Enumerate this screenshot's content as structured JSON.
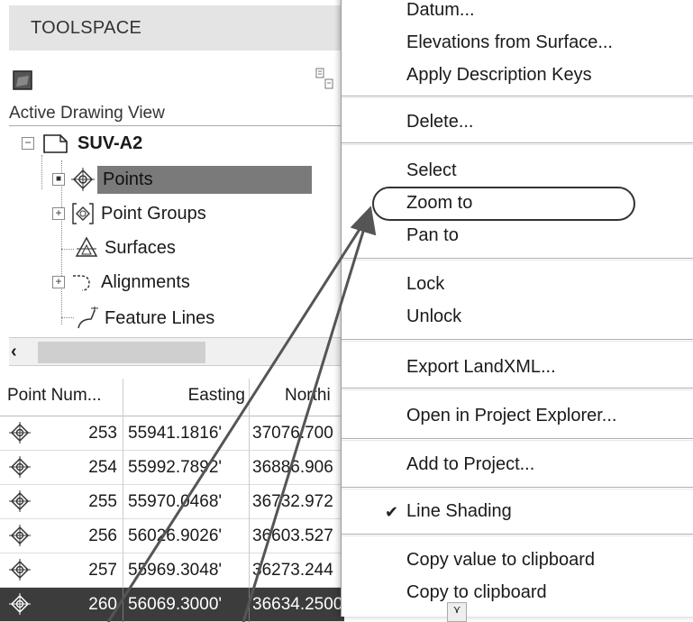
{
  "toolspace": {
    "title": "TOOLSPACE",
    "view_label": "Active Drawing View",
    "tree": [
      {
        "label": "SUV-A2",
        "icon": "drawing-icon",
        "expander": "−"
      },
      {
        "label": "Points",
        "icon": "point-icon",
        "expander": "■"
      },
      {
        "label": "Point Groups",
        "icon": "point-group-icon",
        "expander": "+"
      },
      {
        "label": "Surfaces",
        "icon": "surface-icon",
        "expander": ""
      },
      {
        "label": "Alignments",
        "icon": "alignment-icon",
        "expander": "+"
      },
      {
        "label": "Feature Lines",
        "icon": "feature-line-icon",
        "expander": ""
      }
    ],
    "scroll_left": "‹"
  },
  "grid": {
    "headers": [
      "Point Num...",
      "Easting",
      "Northi"
    ],
    "rows": [
      {
        "num": "253",
        "easting": "55941.1816'",
        "northing": "37076.700"
      },
      {
        "num": "254",
        "easting": "55992.7892'",
        "northing": "36886.906"
      },
      {
        "num": "255",
        "easting": "55970.0468'",
        "northing": "36732.972"
      },
      {
        "num": "256",
        "easting": "56026.9026'",
        "northing": "36603.527"
      },
      {
        "num": "257",
        "easting": "55969.3048'",
        "northing": "36273.244"
      },
      {
        "num": "260",
        "easting": "56069.3000'",
        "northing": "36634.2500"
      }
    ],
    "selected_row": "260"
  },
  "context_menu": {
    "items": {
      "datum": "Datum...",
      "elevations": "Elevations from Surface...",
      "apply_desc": "Apply Description Keys",
      "delete": "Delete...",
      "select": "Select",
      "zoom_to": "Zoom to",
      "pan_to": "Pan to",
      "lock": "Lock",
      "unlock": "Unlock",
      "export": "Export LandXML...",
      "open_pe": "Open in Project Explorer...",
      "add_project": "Add to Project...",
      "line_shading": "Line Shading",
      "copy_value": "Copy value to clipboard",
      "copy": "Copy to clipboard"
    },
    "line_shading_checked": "✔",
    "highlighted_item": "Zoom to"
  },
  "colors": {
    "header_bg": "#e4e4e4",
    "selected_tree_bg": "#7a7a7a",
    "selected_row_bg": "#3c3c3c",
    "callout": "#555555"
  }
}
